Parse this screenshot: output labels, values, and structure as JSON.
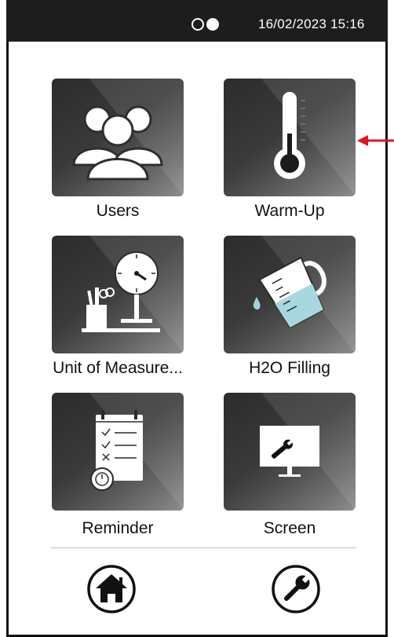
{
  "status_bar": {
    "datetime": "16/02/2023 15:16",
    "page_indicator": {
      "pages": 2,
      "current": 2
    }
  },
  "menu": [
    {
      "label": "Users",
      "icon": "users-icon"
    },
    {
      "label": "Warm-Up",
      "icon": "thermometer-icon"
    },
    {
      "label": "Unit of Measure...",
      "icon": "unit-of-measure-icon"
    },
    {
      "label": "H2O Filling",
      "icon": "measuring-jug-icon"
    },
    {
      "label": "Reminder",
      "icon": "reminder-checklist-icon"
    },
    {
      "label": "Screen",
      "icon": "screen-wrench-icon"
    }
  ],
  "bottom_nav": [
    {
      "icon": "home-icon"
    },
    {
      "icon": "wrench-icon"
    }
  ],
  "colors": {
    "status_bar": "#1d1d1d",
    "tile_dark": "#2c2c2c",
    "accent_arrow": "#e3151a"
  }
}
